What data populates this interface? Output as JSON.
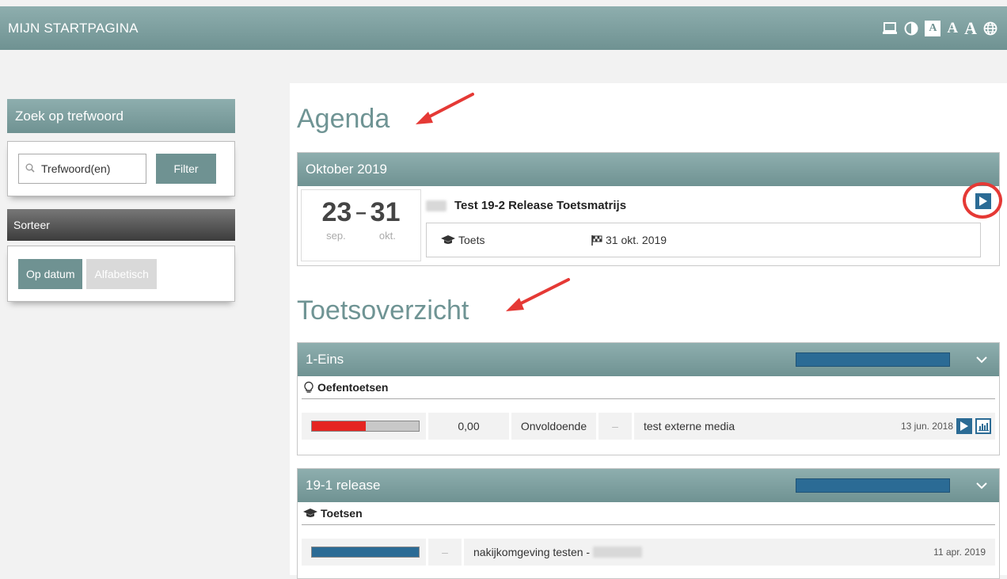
{
  "header": {
    "title": "MIJN STARTPAGINA",
    "tools": [
      {
        "icon": "monitor-icon"
      },
      {
        "icon": "contrast-icon"
      },
      {
        "label": "A"
      },
      {
        "label": "A"
      },
      {
        "label": "A"
      },
      {
        "icon": "globe-icon"
      }
    ]
  },
  "search": {
    "title": "Zoek op trefwoord",
    "placeholder": "Trefwoord(en)",
    "filter_label": "Filter"
  },
  "sort": {
    "title": "Sorteer",
    "by_date": "Op datum",
    "alphabetical": "Alfabetisch"
  },
  "agenda": {
    "title": "Agenda",
    "month": "Oktober 2019",
    "event": {
      "start_day": "23",
      "separator": "–",
      "end_day": "31",
      "start_month": "sep.",
      "end_month": "okt.",
      "title": "Test 19-2 Release Toetsmatrijs",
      "type": "Toets",
      "deadline": "31 okt. 2019"
    }
  },
  "overview": {
    "title": "Toetsoverzicht",
    "groups": [
      {
        "name": "1-Eins",
        "progress": 1.0,
        "subtitle": "Oefentoetsen",
        "rows": [
          {
            "progress": 0.5,
            "bar_color": "#e52521",
            "score": "0,00",
            "grade": "Onvoldoende",
            "dash": "–",
            "name": "test externe media",
            "date": "13 jun. 2018"
          }
        ]
      },
      {
        "name": "19-1 release",
        "progress": 1.0,
        "subtitle": "Toetsen",
        "rows": [
          {
            "progress": 1.0,
            "bar_color": "#2b6b95",
            "dash": "–",
            "name": "nakijkomgeving testen -",
            "date": "11 apr. 2019"
          }
        ]
      }
    ]
  },
  "colors": {
    "accent": "#6f9292",
    "progress_blue": "#2b6b95",
    "fail_red": "#e52521",
    "annotation_red": "#e53935"
  }
}
